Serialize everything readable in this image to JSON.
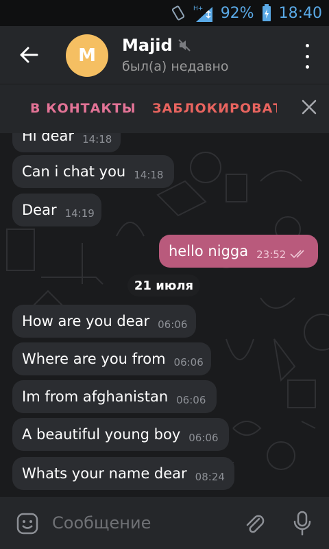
{
  "status": {
    "battery": "92%",
    "time": "18:40",
    "network": "H+"
  },
  "header": {
    "avatar_letter": "M",
    "name": "Majid",
    "last_seen": "был(а) недавно"
  },
  "actions": {
    "add_contact": "В КОНТАКТЫ",
    "block": "ЗАБЛОКИРОВАТЬ"
  },
  "messages": [
    {
      "text": "Hi dear",
      "time": "14:18",
      "dir": "in"
    },
    {
      "text": "Can i chat you",
      "time": "14:18",
      "dir": "in"
    },
    {
      "text": "Dear",
      "time": "14:19",
      "dir": "in"
    },
    {
      "text": "hello nigga",
      "time": "23:52",
      "dir": "out"
    },
    {
      "text": "How are you dear",
      "time": "06:06",
      "dir": "in"
    },
    {
      "text": "Where are you from",
      "time": "06:06",
      "dir": "in"
    },
    {
      "text": "Im from afghanistan",
      "time": "06:06",
      "dir": "in"
    },
    {
      "text": "A beautiful young boy",
      "time": "06:06",
      "dir": "in"
    },
    {
      "text": "Whats your name dear",
      "time": "08:24",
      "dir": "in"
    }
  ],
  "date_separator": "21 июля",
  "input": {
    "placeholder": "Сообщение"
  },
  "colors": {
    "accent": "#e37396",
    "outgoing": "#b95a7c",
    "avatar": "#f5bf62"
  }
}
